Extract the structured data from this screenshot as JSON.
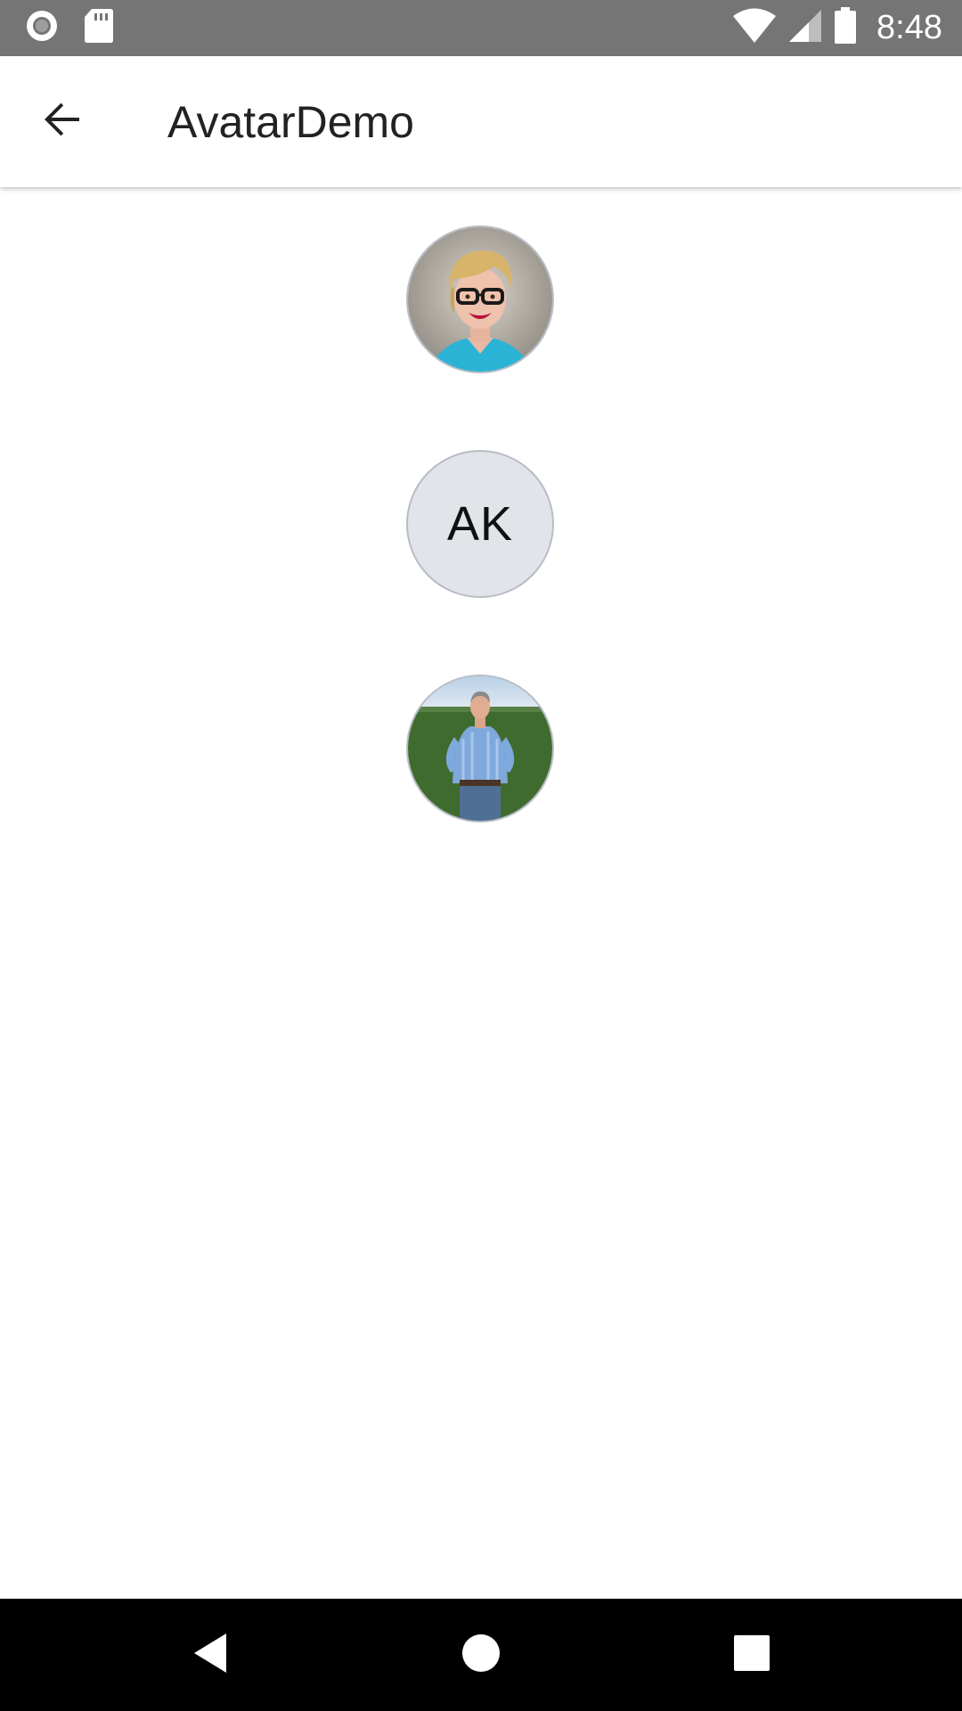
{
  "status_bar": {
    "time": "8:48",
    "icons": [
      "record-icon",
      "sd-card-icon",
      "wifi-icon",
      "signal-icon",
      "battery-icon"
    ],
    "background": "#757575"
  },
  "app_bar": {
    "title": "AvatarDemo",
    "back_icon": "arrow-back-icon"
  },
  "avatars": [
    {
      "kind": "image",
      "description_icon": "woman-portrait-avatar"
    },
    {
      "kind": "initials",
      "initials": "AK",
      "background": "#e1e4e9"
    },
    {
      "kind": "image",
      "description_icon": "man-portrait-avatar"
    }
  ],
  "nav_bar": {
    "buttons": [
      "nav-back-icon",
      "nav-home-icon",
      "nav-recents-icon"
    ],
    "background": "#000000"
  }
}
